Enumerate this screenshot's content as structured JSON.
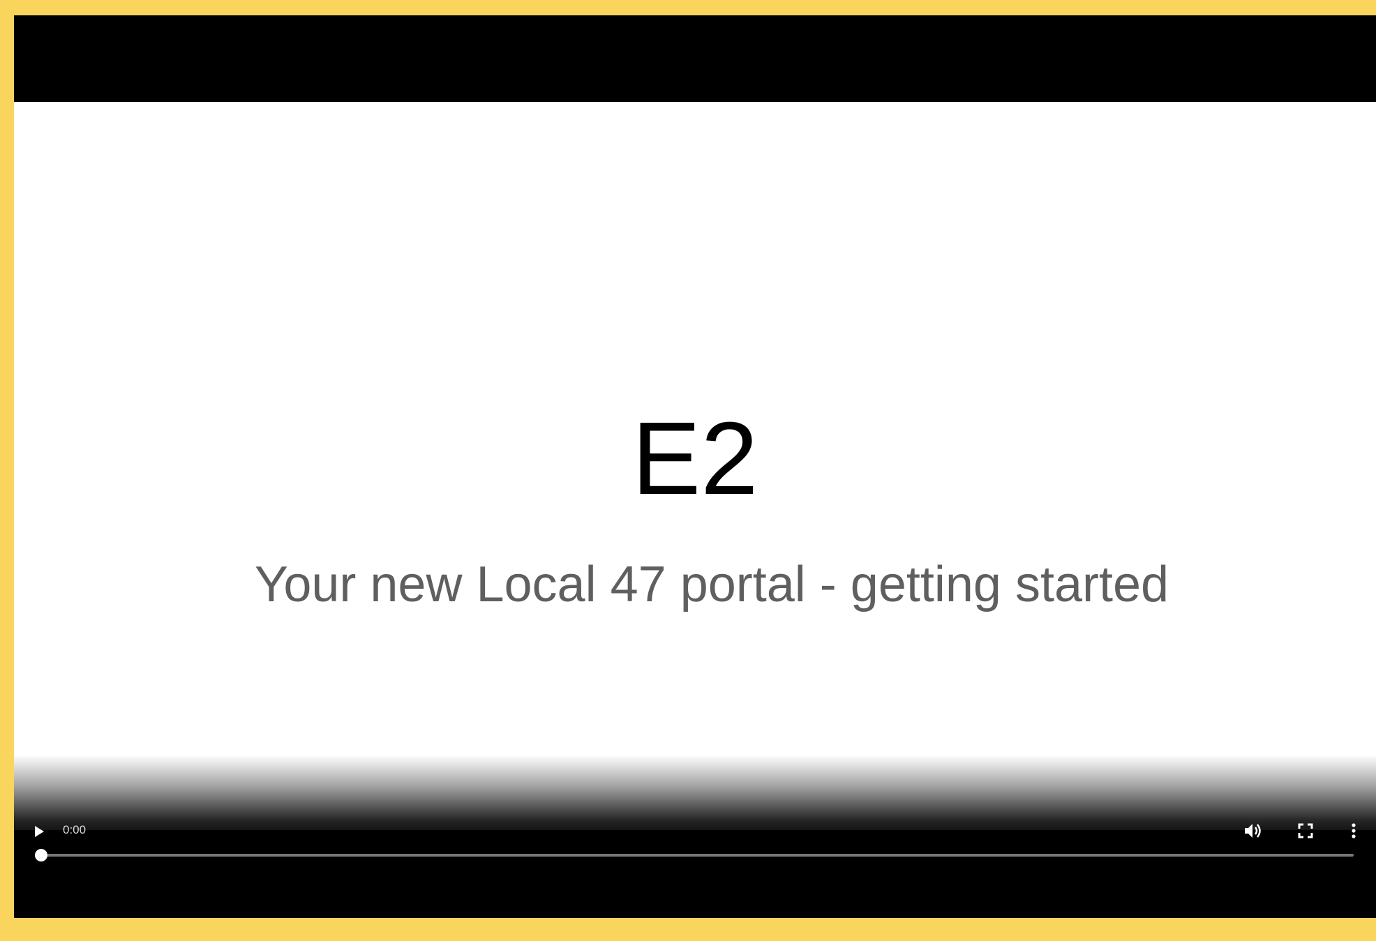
{
  "slide": {
    "title": "E2",
    "subtitle": "Your new Local 47 portal - getting started"
  },
  "player": {
    "current_time": "0:00",
    "progress": 0.0
  },
  "icons": {
    "play": "play-icon",
    "volume": "volume-icon",
    "fullscreen": "fullscreen-icon",
    "more": "more-options-icon"
  },
  "colors": {
    "frame_border": "#F9D55E",
    "player_background": "#000000",
    "slide_background": "#FFFFFF",
    "subtitle_text": "#5F5F5F"
  }
}
